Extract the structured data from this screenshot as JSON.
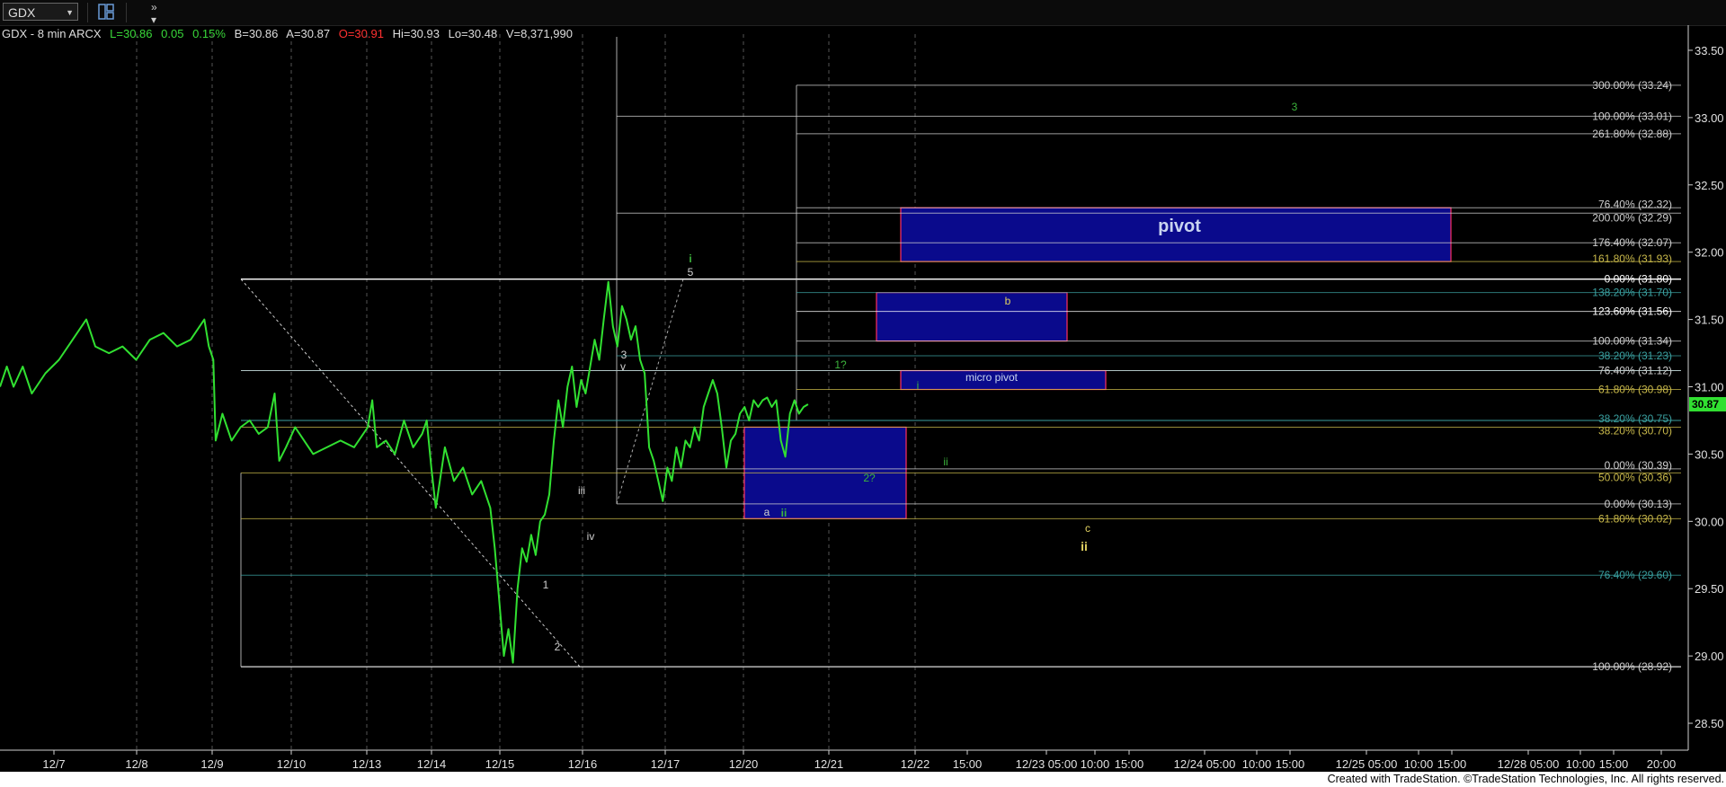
{
  "toolbar": {
    "symbol": "GDX",
    "layout_icon": "window-layout-icon",
    "more_icon": "double-chevron-icon"
  },
  "quote": {
    "symbol_info": "GDX - 8 min  ARCX",
    "last": "L=30.86",
    "change": "0.05",
    "change_pct": "0.15%",
    "bid": "B=30.86",
    "ask": "A=30.87",
    "open": "O=30.91",
    "high": "Hi=30.93",
    "low": "Lo=30.48",
    "volume": "V=8,371,990"
  },
  "chart_data": {
    "type": "line",
    "series": [
      {
        "values": []
      }
    ],
    "x_ticks": [
      "12/7",
      "12/8",
      "12/9",
      "12/10",
      "12/13",
      "12/14",
      "12/15",
      "12/16",
      "12/17",
      "12/20",
      "12/21",
      "12/22",
      "15:00",
      "12/23 05:00",
      "10:00",
      "15:00",
      "12/24 05:00",
      "10:00",
      "15:00",
      "12/25 05:00",
      "10:00",
      "15:00",
      "12/28 05:00",
      "10:00",
      "15:00",
      "20:00"
    ],
    "y_ticks": [
      28.5,
      29.0,
      29.5,
      30.0,
      30.5,
      31.0,
      31.5,
      32.0,
      32.5,
      33.0,
      33.5
    ],
    "ylim": [
      28.3,
      33.6
    ],
    "last_price": "30.87",
    "price": [
      [
        0.0,
        31.0
      ],
      [
        1.5,
        31.15
      ],
      [
        3,
        31.0
      ],
      [
        5,
        31.15
      ],
      [
        7,
        30.95
      ],
      [
        10,
        31.1
      ],
      [
        13,
        31.2
      ],
      [
        16,
        31.35
      ],
      [
        19,
        31.5
      ],
      [
        21,
        31.3
      ],
      [
        24,
        31.25
      ],
      [
        27,
        31.3
      ],
      [
        30,
        31.2
      ],
      [
        33,
        31.35
      ],
      [
        36,
        31.4
      ],
      [
        39,
        31.3
      ],
      [
        42,
        31.35
      ],
      [
        45,
        31.5
      ],
      [
        46,
        31.3
      ],
      [
        47,
        31.2
      ],
      [
        47.5,
        30.6
      ],
      [
        49,
        30.8
      ],
      [
        51,
        30.6
      ],
      [
        53,
        30.7
      ],
      [
        55,
        30.75
      ],
      [
        57,
        30.65
      ],
      [
        59,
        30.7
      ],
      [
        60.5,
        30.95
      ],
      [
        61.5,
        30.45
      ],
      [
        63,
        30.55
      ],
      [
        65,
        30.7
      ],
      [
        67,
        30.6
      ],
      [
        69,
        30.5
      ],
      [
        72,
        30.55
      ],
      [
        75,
        30.6
      ],
      [
        78,
        30.55
      ],
      [
        81,
        30.7
      ],
      [
        82,
        30.9
      ],
      [
        83,
        30.55
      ],
      [
        85,
        30.6
      ],
      [
        87,
        30.5
      ],
      [
        89,
        30.75
      ],
      [
        91,
        30.55
      ],
      [
        93,
        30.65
      ],
      [
        94,
        30.75
      ],
      [
        95,
        30.4
      ],
      [
        96,
        30.1
      ],
      [
        98,
        30.55
      ],
      [
        100,
        30.3
      ],
      [
        102,
        30.4
      ],
      [
        104,
        30.2
      ],
      [
        106,
        30.3
      ],
      [
        108,
        30.1
      ],
      [
        109,
        29.8
      ],
      [
        110,
        29.4
      ],
      [
        111,
        29.0
      ],
      [
        112,
        29.2
      ],
      [
        113,
        28.95
      ],
      [
        114,
        29.5
      ],
      [
        115,
        29.8
      ],
      [
        116,
        29.7
      ],
      [
        117,
        29.9
      ],
      [
        118,
        29.75
      ],
      [
        119,
        30.0
      ],
      [
        120,
        30.05
      ],
      [
        121,
        30.2
      ],
      [
        122,
        30.6
      ],
      [
        123,
        30.9
      ],
      [
        124,
        30.7
      ],
      [
        125,
        31.0
      ],
      [
        126,
        31.15
      ],
      [
        127,
        30.85
      ],
      [
        128,
        31.05
      ],
      [
        129,
        30.95
      ],
      [
        130,
        31.15
      ],
      [
        131,
        31.35
      ],
      [
        132,
        31.2
      ],
      [
        133,
        31.5
      ],
      [
        134,
        31.78
      ],
      [
        135,
        31.45
      ],
      [
        136,
        31.3
      ],
      [
        137,
        31.6
      ],
      [
        138,
        31.5
      ],
      [
        139,
        31.35
      ],
      [
        140,
        31.45
      ],
      [
        141,
        31.2
      ],
      [
        142,
        31.1
      ],
      [
        143,
        30.55
      ],
      [
        144,
        30.45
      ],
      [
        145,
        30.3
      ],
      [
        146,
        30.15
      ],
      [
        147,
        30.4
      ],
      [
        148,
        30.3
      ],
      [
        149,
        30.55
      ],
      [
        150,
        30.4
      ],
      [
        151,
        30.6
      ],
      [
        152,
        30.55
      ],
      [
        153,
        30.7
      ],
      [
        154,
        30.6
      ],
      [
        155,
        30.85
      ],
      [
        156,
        30.95
      ],
      [
        157,
        31.05
      ],
      [
        158,
        30.95
      ],
      [
        159,
        30.7
      ],
      [
        160,
        30.4
      ],
      [
        161,
        30.6
      ],
      [
        162,
        30.65
      ],
      [
        163,
        30.8
      ],
      [
        164,
        30.85
      ],
      [
        165,
        30.75
      ],
      [
        166,
        30.9
      ],
      [
        167,
        30.85
      ],
      [
        168,
        30.9
      ],
      [
        169,
        30.92
      ],
      [
        170,
        30.85
      ],
      [
        171,
        30.9
      ],
      [
        172,
        30.6
      ],
      [
        173,
        30.48
      ],
      [
        174,
        30.8
      ],
      [
        175,
        30.9
      ],
      [
        176,
        30.8
      ],
      [
        177,
        30.85
      ],
      [
        178,
        30.87
      ]
    ],
    "fib_levels": [
      {
        "label": "300.00% (33.24)",
        "price": 33.24,
        "color": "#d0d0d0"
      },
      {
        "label": "100.00% (33.01)",
        "price": 33.01,
        "color": "#d0d0d0"
      },
      {
        "label": "261.80% (32.88)",
        "price": 32.88,
        "color": "#d0d0d0"
      },
      {
        "label": "76.40% (32.32)",
        "price": 32.33,
        "color": "#d0d0d0"
      },
      {
        "label": "200.00% (32.29)",
        "price": 32.29,
        "color": "#d0d0d0"
      },
      {
        "label": "176.40% (32.07)",
        "price": 32.07,
        "color": "#d0d0d0"
      },
      {
        "label": "161.80% (31.93)",
        "price": 31.93,
        "color": "#c8b84a"
      },
      {
        "label": "0.00% (31.80)",
        "price": 31.8,
        "color": "#ffffff"
      },
      {
        "label": "138.20% (31.70)",
        "price": 31.7,
        "color": "#3aa0a0"
      },
      {
        "label": "123.60% (31.56)",
        "price": 31.56,
        "color": "#ffffff"
      },
      {
        "label": "100.00% (31.34)",
        "price": 31.34,
        "color": "#d0d0d0"
      },
      {
        "label": "38.20% (31.23)",
        "price": 31.23,
        "color": "#3aa0a0"
      },
      {
        "label": "76.40% (31.12)",
        "price": 31.12,
        "color": "#d0d0d0"
      },
      {
        "label": "61.80% (30.98)",
        "price": 30.98,
        "color": "#c8b84a"
      },
      {
        "label": "38.20% (30.75)",
        "price": 30.75,
        "color": "#3aa0a0"
      },
      {
        "label": "38.20% (30.70)",
        "price": 30.7,
        "color": "#c8b84a"
      },
      {
        "label": "0.00% (30.39)",
        "price": 30.39,
        "color": "#d0d0d0"
      },
      {
        "label": "50.00% (30.36)",
        "price": 30.36,
        "color": "#c8b84a"
      },
      {
        "label": "0.00% (30.13)",
        "price": 30.13,
        "color": "#d0d0d0"
      },
      {
        "label": "61.80% (30.02)",
        "price": 30.02,
        "color": "#c8b84a"
      },
      {
        "label": "76.40% (29.60)",
        "price": 29.6,
        "color": "#3aa0a0"
      },
      {
        "label": "100.00% (28.92)",
        "price": 28.92,
        "color": "#d0d0d0"
      }
    ],
    "annotations": [
      {
        "text": "pivot",
        "color": "#c8d4f0"
      },
      {
        "text": "b",
        "color": "#e0d060"
      },
      {
        "text": "micro pivot",
        "color": "#c8d4f0"
      },
      {
        "text": "3",
        "color": "#3cb43c"
      },
      {
        "text": "i",
        "color": "#3cb43c"
      },
      {
        "text": "5",
        "color": "#d0d0d0"
      },
      {
        "text": "3",
        "color": "#d0d0d0"
      },
      {
        "text": "v",
        "color": "#d0d0d0"
      },
      {
        "text": "iii",
        "color": "#d0d0d0"
      },
      {
        "text": "iv",
        "color": "#d0d0d0"
      },
      {
        "text": "1",
        "color": "#d0d0d0"
      },
      {
        "text": "2",
        "color": "#d0d0d0"
      },
      {
        "text": "a",
        "color": "#d0d0d0"
      },
      {
        "text": "ii",
        "color": "#3cb43c"
      },
      {
        "text": "1?",
        "color": "#3cb43c"
      },
      {
        "text": "2?",
        "color": "#3cb43c"
      },
      {
        "text": "i",
        "color": "#3cb43c"
      },
      {
        "text": "ii",
        "color": "#3cb43c"
      },
      {
        "text": "c",
        "color": "#e0d060"
      },
      {
        "text": "ii",
        "color": "#e0d060"
      }
    ]
  },
  "footer": {
    "credit": "Created with TradeStation. ©TradeStation Technologies, Inc. All rights reserved."
  }
}
